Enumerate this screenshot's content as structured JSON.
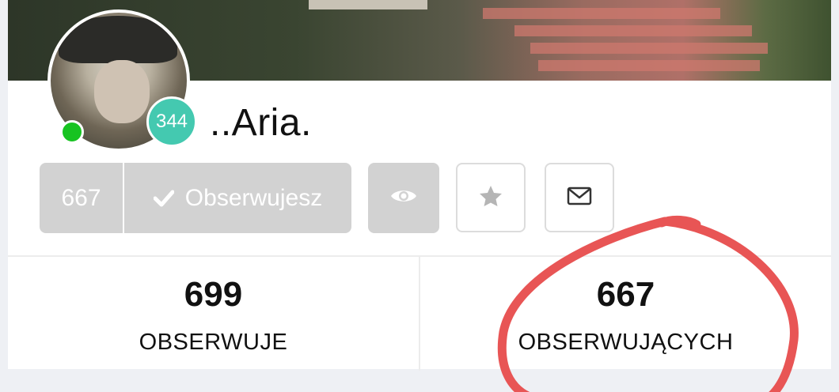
{
  "profile": {
    "username": "..Aria.",
    "level": "344",
    "online": true
  },
  "actions": {
    "follower_count": "667",
    "follow_label": "Obserwujesz"
  },
  "stats": [
    {
      "value": "699",
      "label": "OBSERWUJE"
    },
    {
      "value": "667",
      "label": "OBSERWUJĄCYCH"
    }
  ],
  "colors": {
    "level_badge": "#44c9b0",
    "online": "#17c321",
    "button_gray": "#d2d2d2",
    "annotation": "#e85555"
  },
  "icons": {
    "check": "check-icon",
    "eye": "eye-icon",
    "star": "star-icon",
    "envelope": "envelope-icon"
  }
}
